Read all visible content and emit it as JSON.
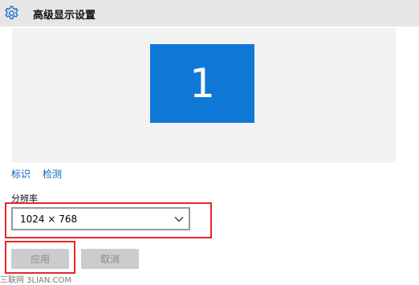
{
  "window": {
    "title": "高级显示设置",
    "icon": "gear-icon"
  },
  "preview": {
    "monitor_number": "1",
    "monitor_color": "#0f78d6"
  },
  "links": {
    "identify": "标识",
    "detect": "检测"
  },
  "resolution": {
    "label": "分辨率",
    "value": "1024 × 768"
  },
  "buttons": {
    "apply": "应用",
    "cancel": "取消"
  },
  "highlight_color": "#e8262b",
  "watermark": "三联网 3LIAN.COM"
}
